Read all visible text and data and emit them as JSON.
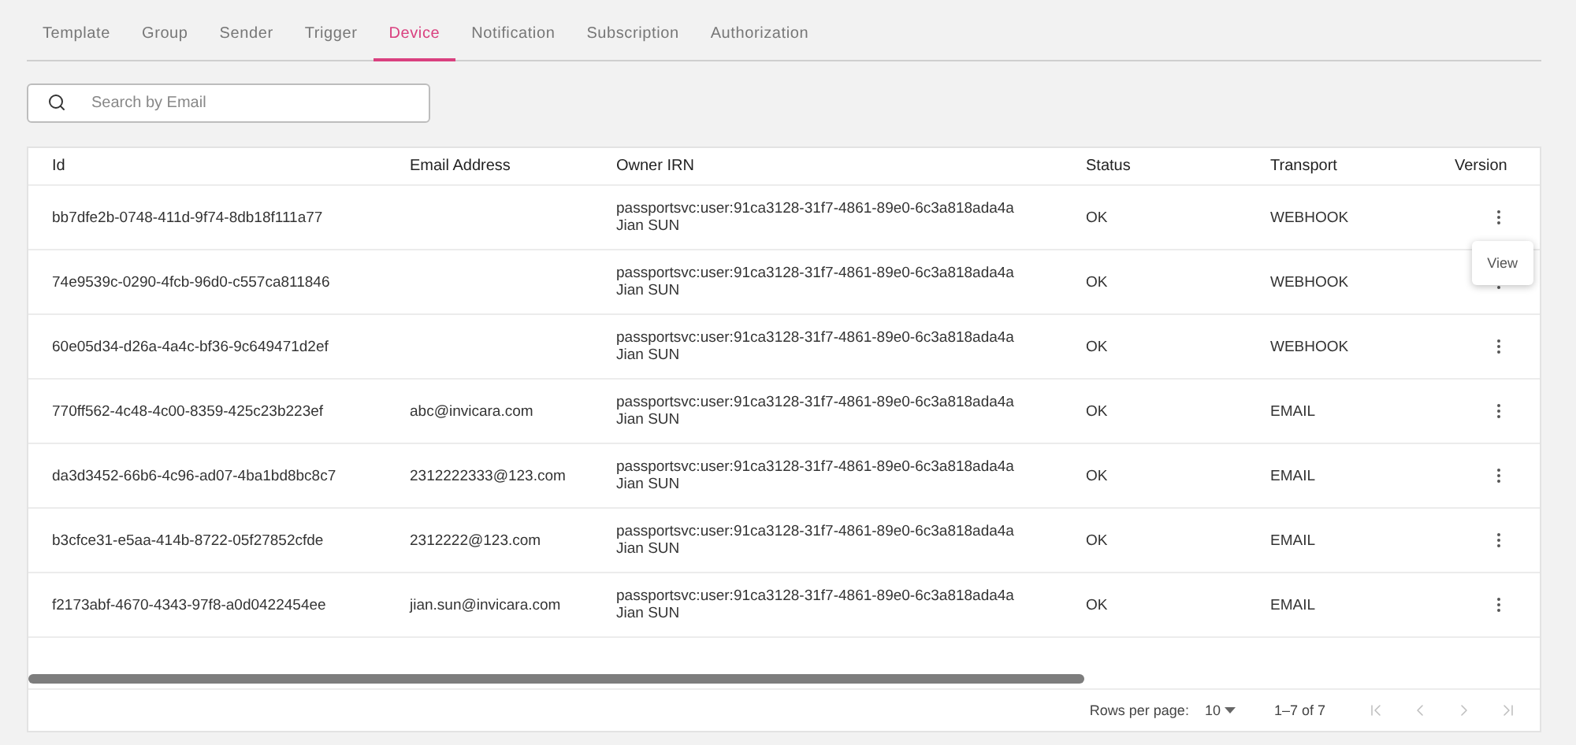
{
  "tabs": [
    {
      "label": "Template",
      "selected": false
    },
    {
      "label": "Group",
      "selected": false
    },
    {
      "label": "Sender",
      "selected": false
    },
    {
      "label": "Trigger",
      "selected": false
    },
    {
      "label": "Device",
      "selected": true
    },
    {
      "label": "Notification",
      "selected": false
    },
    {
      "label": "Subscription",
      "selected": false
    },
    {
      "label": "Authorization",
      "selected": false
    }
  ],
  "search": {
    "placeholder": "Search by Email"
  },
  "table": {
    "columns": [
      "Id",
      "Email Address",
      "Owner IRN",
      "Status",
      "Transport",
      "Version"
    ],
    "rows": [
      {
        "id": "bb7dfe2b-0748-411d-9f74-8db18f111a77",
        "email": "",
        "owner_irn": "passportsvc:user:91ca3128-31f7-4861-89e0-6c3a818ada4a",
        "owner_name": "Jian SUN",
        "status": "OK",
        "transport": "WEBHOOK"
      },
      {
        "id": "74e9539c-0290-4fcb-96d0-c557ca811846",
        "email": "",
        "owner_irn": "passportsvc:user:91ca3128-31f7-4861-89e0-6c3a818ada4a",
        "owner_name": "Jian SUN",
        "status": "OK",
        "transport": "WEBHOOK"
      },
      {
        "id": "60e05d34-d26a-4a4c-bf36-9c649471d2ef",
        "email": "",
        "owner_irn": "passportsvc:user:91ca3128-31f7-4861-89e0-6c3a818ada4a",
        "owner_name": "Jian SUN",
        "status": "OK",
        "transport": "WEBHOOK"
      },
      {
        "id": "770ff562-4c48-4c00-8359-425c23b223ef",
        "email": "abc@invicara.com",
        "owner_irn": "passportsvc:user:91ca3128-31f7-4861-89e0-6c3a818ada4a",
        "owner_name": "Jian SUN",
        "status": "OK",
        "transport": "EMAIL"
      },
      {
        "id": "da3d3452-66b6-4c96-ad07-4ba1bd8bc8c7",
        "email": "2312222333@123.com",
        "owner_irn": "passportsvc:user:91ca3128-31f7-4861-89e0-6c3a818ada4a",
        "owner_name": "Jian SUN",
        "status": "OK",
        "transport": "EMAIL"
      },
      {
        "id": "b3cfce31-e5aa-414b-8722-05f27852cfde",
        "email": "2312222@123.com",
        "owner_irn": "passportsvc:user:91ca3128-31f7-4861-89e0-6c3a818ada4a",
        "owner_name": "Jian SUN",
        "status": "OK",
        "transport": "EMAIL"
      },
      {
        "id": "f2173abf-4670-4343-97f8-a0d0422454ee",
        "email": "jian.sun@invicara.com",
        "owner_irn": "passportsvc:user:91ca3128-31f7-4861-89e0-6c3a818ada4a",
        "owner_name": "Jian SUN",
        "status": "OK",
        "transport": "EMAIL"
      }
    ]
  },
  "row_menu": {
    "items": [
      "View"
    ]
  },
  "pagination": {
    "rows_per_page_label": "Rows per page:",
    "rows_per_page": "10",
    "range": "1–7 of 7",
    "first_disabled": true,
    "prev_disabled": true,
    "next_disabled": true,
    "last_disabled": true
  }
}
